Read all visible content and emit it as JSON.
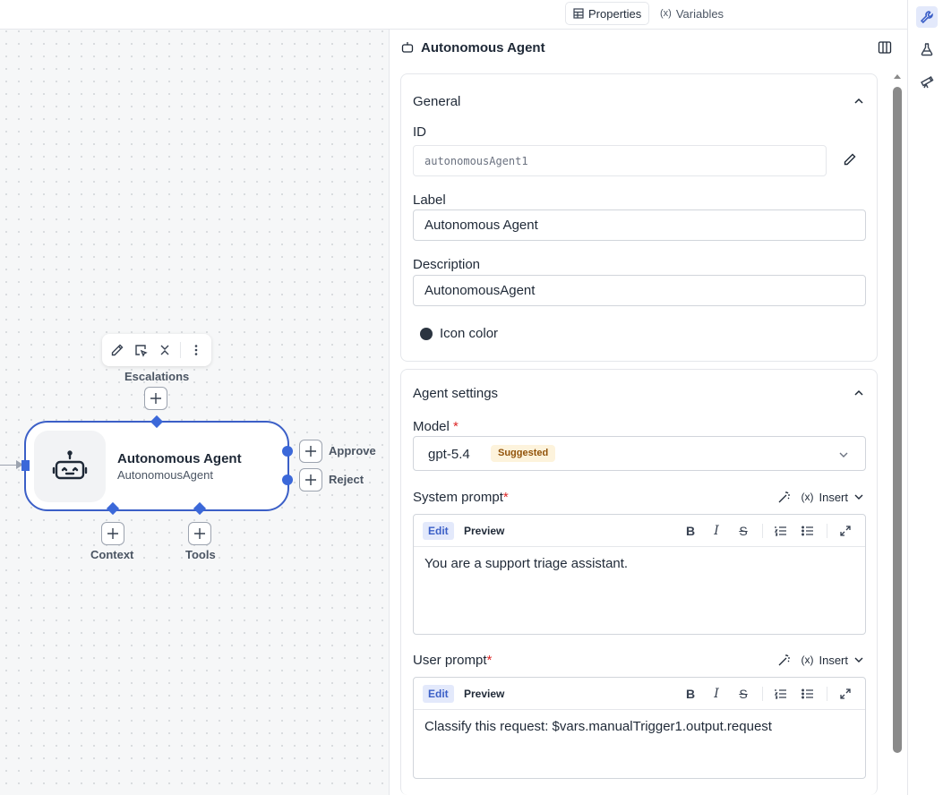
{
  "canvas": {
    "toolbar": {
      "edit": "edit-icon",
      "select": "select-icon",
      "collapse": "collapse-icon",
      "more": "more-vertical-icon"
    },
    "node": {
      "title": "Autonomous Agent",
      "subtitle": "AutonomousAgent",
      "icon": "robot-icon"
    },
    "ports": {
      "escalations": "Escalations",
      "approve": "Approve",
      "reject": "Reject",
      "context": "Context",
      "tools": "Tools"
    }
  },
  "panel": {
    "tabs": [
      {
        "label": "Properties",
        "icon": "table-icon",
        "active": true
      },
      {
        "label": "Variables",
        "icon": "variable-icon",
        "active": false
      }
    ],
    "header_title": "Autonomous Agent",
    "general": {
      "title": "General",
      "id_label": "ID",
      "id_value": "autonomousAgent1",
      "label_label": "Label",
      "label_value": "Autonomous Agent",
      "description_label": "Description",
      "description_value": "AutonomousAgent",
      "icon_color_label": "Icon color",
      "icon_color": "#2b3440"
    },
    "agent_settings": {
      "title": "Agent settings",
      "model_label": "Model",
      "required_mark": "*",
      "model_value": "gpt-5.4",
      "model_badge": "Suggested",
      "system_prompt_label": "System prompt",
      "user_prompt_label": "User prompt",
      "insert_label": "Insert",
      "edit_mode": "Edit",
      "preview_mode": "Preview",
      "system_prompt_text": "You are a support triage assistant.",
      "user_prompt_text": "Classify this request: $vars.manualTrigger1.output.request"
    }
  },
  "colors": {
    "accent": "#3b68d9",
    "required": "#dc2626",
    "badge_bg": "#fdf3dc",
    "badge_text": "#92530a"
  }
}
